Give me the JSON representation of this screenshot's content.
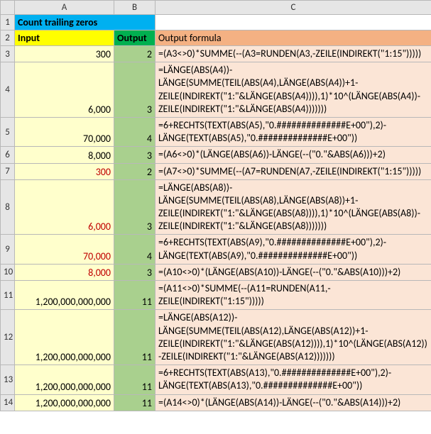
{
  "columns": {
    "A": "A",
    "B": "B",
    "C": "C"
  },
  "title": "Count trailing zeros",
  "headers": {
    "input": "Input",
    "output": "Output",
    "formula": "Output formula"
  },
  "rows": [
    {
      "n": "3",
      "sep": false,
      "a": "300",
      "neg": false,
      "b": "2",
      "c": "=(A3<>0)*SUMME(--(A3=RUNDEN(A3,-ZEILE(INDIREKT(\"1:15\")))))"
    },
    {
      "n": "4",
      "sep": false,
      "a": "6,000",
      "neg": false,
      "b": "3",
      "c": "=LÄNGE(ABS(A4))-LÄNGE(SUMME(TEIL(ABS(A4),LÄNGE(ABS(A4))+1-ZEILE(INDIREKT(\"1:\"&LÄNGE(ABS(A4)))),1)*10^(LÄNGE(ABS(A4))-ZEILE(INDIREKT(\"1:\"&LÄNGE(ABS(A4)))))))"
    },
    {
      "n": "5",
      "sep": false,
      "a": "70,000",
      "neg": false,
      "b": "4",
      "c": "=6+RECHTS(TEXT(ABS(A5),\"0.##############E+00\"),2)-LÄNGE(TEXT(ABS(A5),\"0.##############E+00\"))"
    },
    {
      "n": "6",
      "sep": false,
      "a": "8,000",
      "neg": false,
      "b": "3",
      "c": "=(A6<>0)*(LÄNGE(ABS(A6))-LÄNGE(--(\"0.\"&ABS(A6)))+2)"
    },
    {
      "n": "7",
      "sep": true,
      "a": "300",
      "neg": true,
      "b": "2",
      "c": "=(A7<>0)*SUMME(--(A7=RUNDEN(A7,-ZEILE(INDIREKT(\"1:15\")))))"
    },
    {
      "n": "8",
      "sep": false,
      "a": "6,000",
      "neg": true,
      "b": "3",
      "c": "=LÄNGE(ABS(A8))-LÄNGE(SUMME(TEIL(ABS(A8),LÄNGE(ABS(A8))+1-ZEILE(INDIREKT(\"1:\"&LÄNGE(ABS(A8)))),1)*10^(LÄNGE(ABS(A8))-ZEILE(INDIREKT(\"1:\"&LÄNGE(ABS(A8)))))))"
    },
    {
      "n": "9",
      "sep": false,
      "a": "70,000",
      "neg": true,
      "b": "4",
      "c": "=6+RECHTS(TEXT(ABS(A9),\"0.##############E+00\"),2)-LÄNGE(TEXT(ABS(A9),\"0.##############E+00\"))"
    },
    {
      "n": "10",
      "sep": false,
      "a": "8,000",
      "neg": true,
      "b": "3",
      "c": "=(A10<>0)*(LÄNGE(ABS(A10))-LÄNGE(--(\"0.\"&ABS(A10)))+2)"
    },
    {
      "n": "11",
      "sep": true,
      "a": "1,200,000,000,000",
      "neg": false,
      "b": "11",
      "c": "=(A11<>0)*SUMME(--(A11=RUNDEN(A11,-ZEILE(INDIREKT(\"1:15\")))))"
    },
    {
      "n": "12",
      "sep": false,
      "a": "1,200,000,000,000",
      "neg": false,
      "b": "11",
      "c": "=LÄNGE(ABS(A12))-LÄNGE(SUMME(TEIL(ABS(A12),LÄNGE(ABS(A12))+1-ZEILE(INDIREKT(\"1:\"&LÄNGE(ABS(A12)))),1)*10^(LÄNGE(ABS(A12))-ZEILE(INDIREKT(\"1:\"&LÄNGE(ABS(A12)))))))"
    },
    {
      "n": "13",
      "sep": false,
      "a": "1,200,000,000,000",
      "neg": false,
      "b": "11",
      "c": "=6+RECHTS(TEXT(ABS(A13),\"0.##############E+00\"),2)-LÄNGE(TEXT(ABS(A13),\"0.##############E+00\"))"
    },
    {
      "n": "14",
      "sep": false,
      "a": "1,200,000,000,000",
      "neg": false,
      "b": "11",
      "c": "=(A14<>0)*(LÄNGE(ABS(A14))-LÄNGE(--(\"0.\"&ABS(A14)))+2)"
    }
  ],
  "chart_data": {
    "type": "table",
    "title": "Count trailing zeros",
    "columns": [
      "Input",
      "Output",
      "Output formula"
    ],
    "rows": [
      [
        300,
        2,
        "=(A3<>0)*SUMME(--(A3=RUNDEN(A3,-ZEILE(INDIREKT(\"1:15\")))))"
      ],
      [
        6000,
        3,
        "=LÄNGE(ABS(A4))-LÄNGE(SUMME(TEIL(ABS(A4),LÄNGE(ABS(A4))+1-ZEILE(INDIREKT(\"1:\"&LÄNGE(ABS(A4)))),1)*10^(LÄNGE(ABS(A4))-ZEILE(INDIREKT(\"1:\"&LÄNGE(ABS(A4)))))))"
      ],
      [
        70000,
        4,
        "=6+RECHTS(TEXT(ABS(A5),\"0.##############E+00\"),2)-LÄNGE(TEXT(ABS(A5),\"0.##############E+00\"))"
      ],
      [
        8000,
        3,
        "=(A6<>0)*(LÄNGE(ABS(A6))-LÄNGE(--(\"0.\"&ABS(A6)))+2)"
      ],
      [
        -300,
        2,
        "=(A7<>0)*SUMME(--(A7=RUNDEN(A7,-ZEILE(INDIREKT(\"1:15\")))))"
      ],
      [
        -6000,
        3,
        "=LÄNGE(ABS(A8))-LÄNGE(SUMME(TEIL(ABS(A8),LÄNGE(ABS(A8))+1-ZEILE(INDIREKT(\"1:\"&LÄNGE(ABS(A8)))),1)*10^(LÄNGE(ABS(A8))-ZEILE(INDIREKT(\"1:\"&LÄNGE(ABS(A8)))))))"
      ],
      [
        -70000,
        4,
        "=6+RECHTS(TEXT(ABS(A9),\"0.##############E+00\"),2)-LÄNGE(TEXT(ABS(A9),\"0.##############E+00\"))"
      ],
      [
        -8000,
        3,
        "=(A10<>0)*(LÄNGE(ABS(A10))-LÄNGE(--(\"0.\"&ABS(A10)))+2)"
      ],
      [
        1200000000000,
        11,
        "=(A11<>0)*SUMME(--(A11=RUNDEN(A11,-ZEILE(INDIREKT(\"1:15\")))))"
      ],
      [
        1200000000000,
        11,
        "=LÄNGE(ABS(A12))-LÄNGE(SUMME(TEIL(ABS(A12),LÄNGE(ABS(A12))+1-ZEILE(INDIREKT(\"1:\"&LÄNGE(ABS(A12)))),1)*10^(LÄNGE(ABS(A12))-ZEILE(INDIREKT(\"1:\"&LÄNGE(ABS(A12)))))))"
      ],
      [
        1200000000000,
        11,
        "=6+RECHTS(TEXT(ABS(A13),\"0.##############E+00\"),2)-LÄNGE(TEXT(ABS(A13),\"0.##############E+00\"))"
      ],
      [
        1200000000000,
        11,
        "=(A14<>0)*(LÄNGE(ABS(A14))-LÄNGE(--(\"0.\"&ABS(A14)))+2)"
      ]
    ]
  }
}
